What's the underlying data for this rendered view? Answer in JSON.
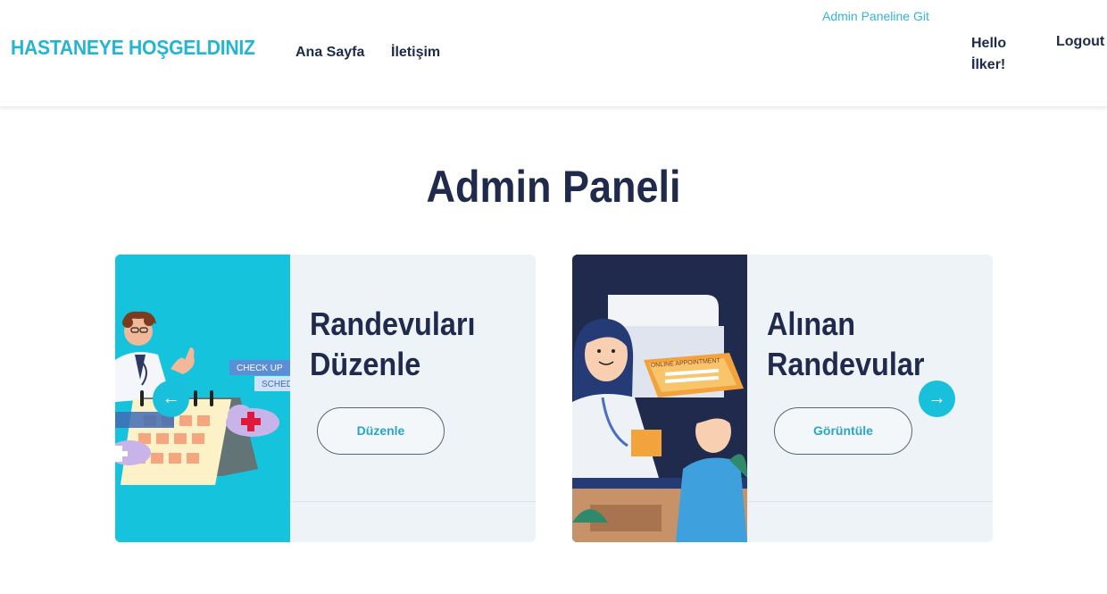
{
  "header": {
    "brand": "HASTANEYE HOŞGELDINIZ",
    "nav": {
      "home": "Ana Sayfa",
      "contact": "İletişim"
    },
    "admin_link": "Admin Paneline Git",
    "greeting_line1": "Hello",
    "greeting_line2": "İlker!",
    "logout": "Logout"
  },
  "page_title": "Admin Paneli",
  "cards": [
    {
      "title_line1": "Randevuları",
      "title_line2": "Düzenle",
      "button": "Düzenle",
      "image_labels": [
        "CHECK UP",
        "SCHED"
      ]
    },
    {
      "title_line1": "Alınan",
      "title_line2": "Randevular",
      "button": "Görüntüle",
      "image_labels": [
        "ONLINE APPOINTMENT"
      ]
    }
  ],
  "carousel": {
    "prev_icon": "arrow-left-icon",
    "next_icon": "arrow-right-icon",
    "prev_glyph": "←",
    "next_glyph": "→"
  },
  "colors": {
    "brand": "#24b6d1",
    "accent": "#19c0dc",
    "heading": "#1f2a4d",
    "card_bg": "#eef3f8"
  }
}
